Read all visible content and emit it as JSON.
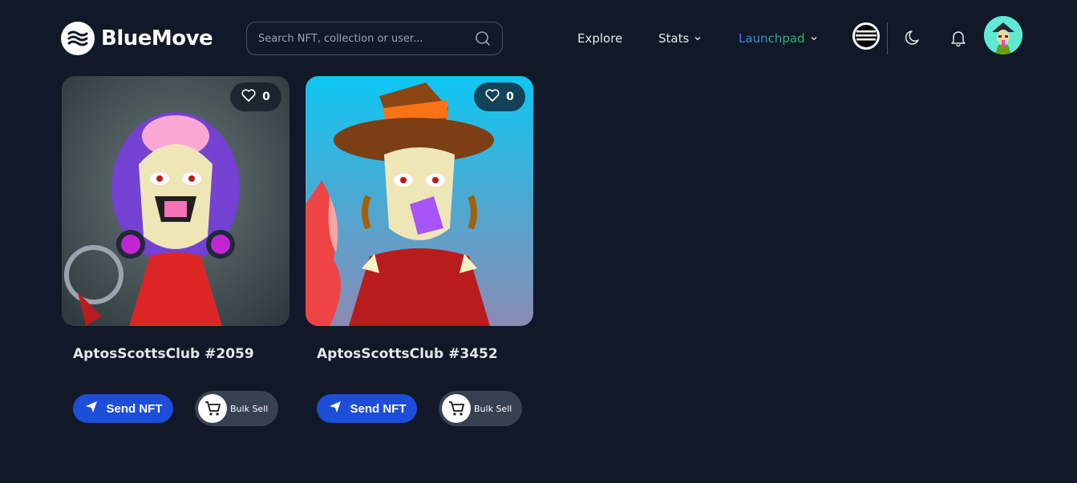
{
  "brand": {
    "name": "BlueMove"
  },
  "search": {
    "placeholder": "Search NFT, collection or user..."
  },
  "nav": {
    "explore": "Explore",
    "stats": "Stats",
    "launchpad": "Launchpad"
  },
  "icons": {
    "logo": "bluemove-logo-icon",
    "search": "search-icon",
    "chain": "aptos-icon",
    "theme": "moon-icon",
    "notifications": "bell-icon",
    "like": "heart-icon",
    "send": "send-icon",
    "bulk": "cart-icon"
  },
  "colors": {
    "background": "#111827",
    "primary_button": "#1d4ed8",
    "secondary_button": "#374151"
  },
  "cards": [
    {
      "title": "AptosScottsClub #2059",
      "likes": "0",
      "send_label": "Send NFT",
      "bulk_label": "Bulk Sell"
    },
    {
      "title": "AptosScottsClub #3452",
      "likes": "0",
      "send_label": "Send NFT",
      "bulk_label": "Bulk Sell"
    }
  ]
}
